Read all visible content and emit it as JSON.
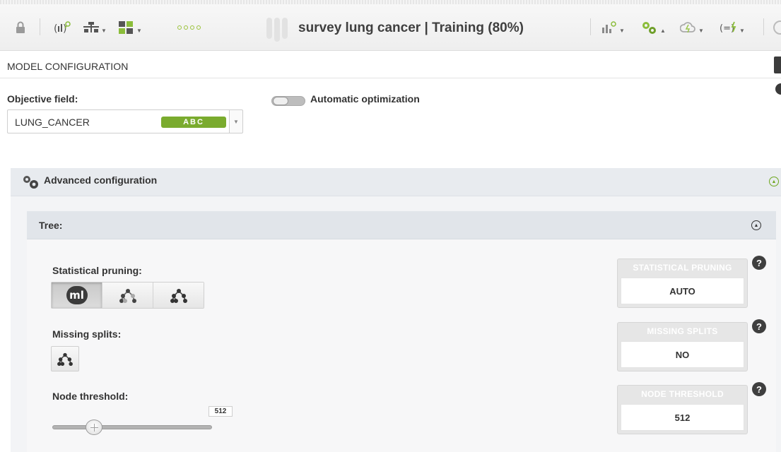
{
  "window": {
    "title": "survey lung cancer | Training (80%)"
  },
  "section": {
    "title": "MODEL CONFIGURATION"
  },
  "objective": {
    "label": "Objective field:",
    "value": "LUNG_CANCER",
    "type_badge": "ABC"
  },
  "optimization": {
    "label": "Automatic optimization",
    "enabled": false
  },
  "advanced": {
    "title": "Advanced configuration"
  },
  "tree": {
    "title": "Tree:",
    "statistical_pruning_label": "Statistical pruning:",
    "ml_logo": "ml",
    "missing_splits_label": "Missing splits:",
    "node_threshold_label": "Node threshold:",
    "node_threshold_value": "512"
  },
  "summary": {
    "statistical_pruning": {
      "caption": "STATISTICAL PRUNING",
      "value": "AUTO"
    },
    "missing_splits": {
      "caption": "MISSING SPLITS",
      "value": "NO"
    },
    "node_threshold": {
      "caption": "NODE THRESHOLD",
      "value": "512"
    }
  },
  "help_glyph": "?",
  "colors": {
    "accent_green": "#7aab2e",
    "panel_header": "#e8ebef",
    "help_dark": "#3f3f3f"
  }
}
